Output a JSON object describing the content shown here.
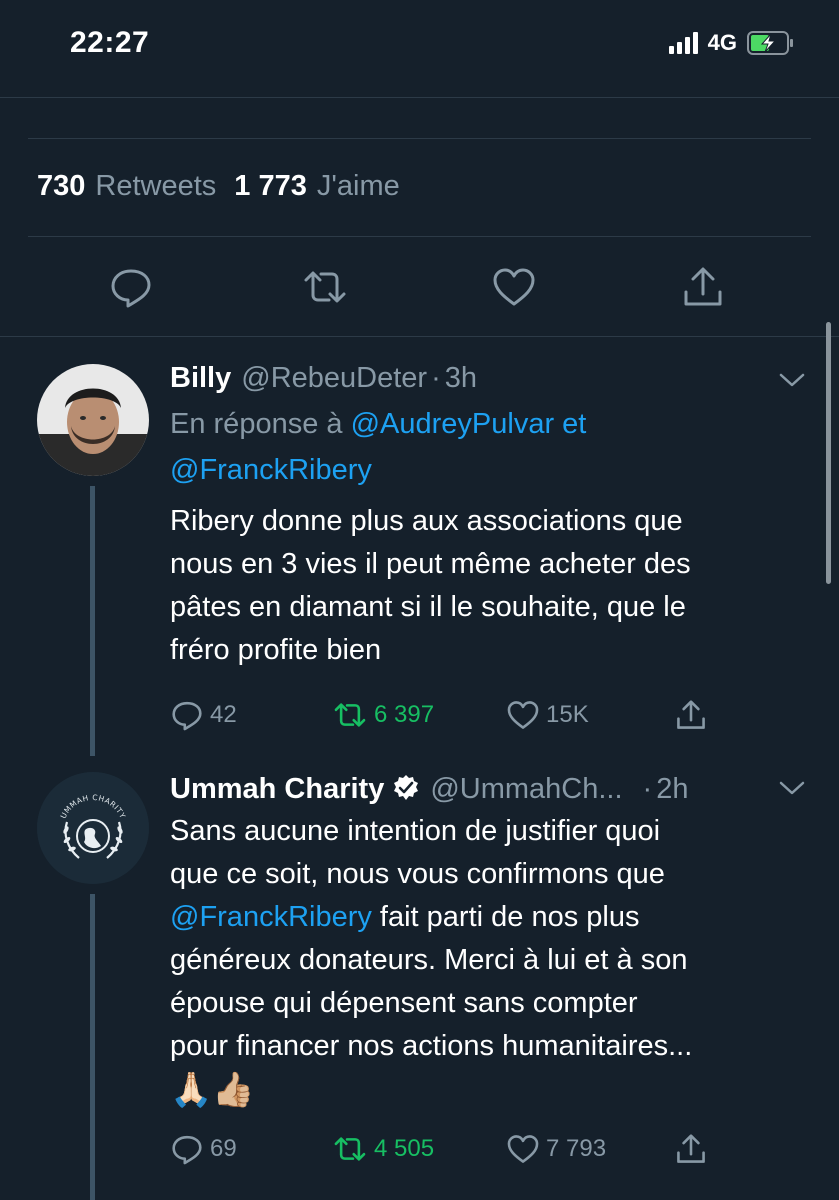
{
  "status": {
    "time": "22:27",
    "network": "4G"
  },
  "stats": {
    "retweets_count": "730",
    "retweets_label": "Retweets",
    "likes_count": "1 773",
    "likes_label": "J'aime"
  },
  "tweets": [
    {
      "name": "Billy",
      "handle": "@RebeuDeter",
      "dot": "·",
      "time": "3h",
      "reply_prefix": "En réponse à",
      "reply_mention1": "@AudreyPulvar",
      "reply_and": "et",
      "reply_mention2": "@FranckRibery",
      "lines": [
        "Ribery donne plus aux associations que",
        "nous en 3 vies il peut même acheter des",
        "pâtes en diamant si il le souhaite, que le",
        "fréro profite bien"
      ],
      "replies": "42",
      "retweets": "6 397",
      "likes": "15K"
    },
    {
      "name": "Ummah Charity",
      "handle": "@UmmahCh...",
      "dot": "·",
      "time": "2h",
      "line1": "Sans aucune intention de justifier quoi",
      "line2": "que ce soit, nous vous confirmons que",
      "line3_mention": "@FranckRibery",
      "line3_rest": " fait parti de nos plus",
      "line4": "généreux donateurs. Merci à lui et à son",
      "line5": "épouse qui dépensent sans compter",
      "line6": "pour financer nos actions humanitaires...",
      "emojis": "🙏🏻👍🏼",
      "replies": "69",
      "retweets": "4 505",
      "likes": "7 793"
    }
  ],
  "logo_text": "UMMAH CHARITY"
}
